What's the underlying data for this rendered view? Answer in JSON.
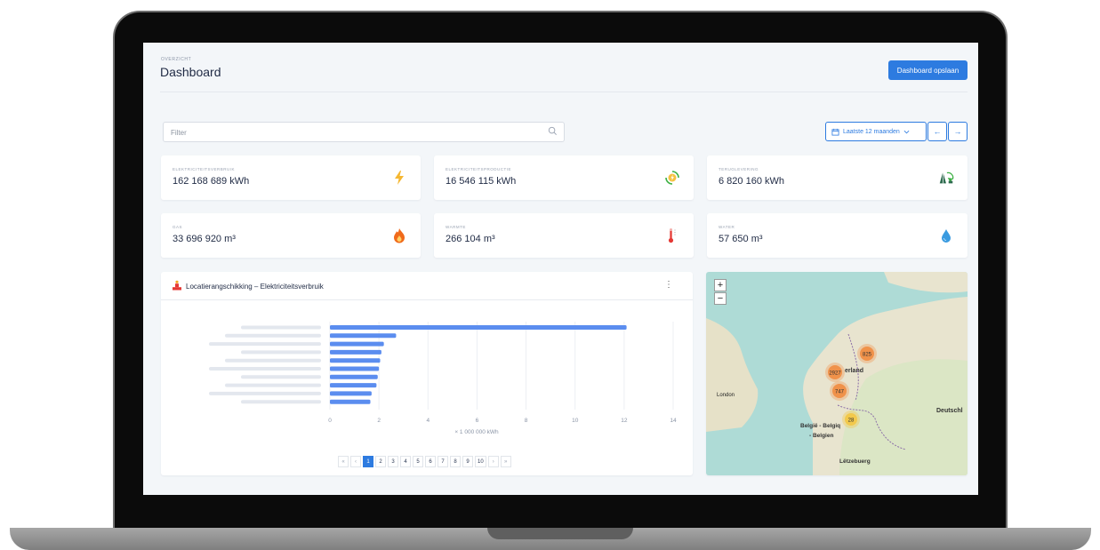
{
  "header": {
    "eyebrow": "OVERZICHT",
    "title": "Dashboard",
    "save_label": "Dashboard opslaan"
  },
  "filter": {
    "placeholder": "Filter"
  },
  "period": {
    "label": "Laatste 12 maanden",
    "prev": "←",
    "next": "→"
  },
  "kpis": [
    {
      "label": "ELEKTRICITEITSVERBRUIK",
      "value": "162 168 689 kWh",
      "icon": "lightning-icon",
      "color": "#f5b731"
    },
    {
      "label": "ELEKTRICITEITSPRODUCTIE",
      "value": "16 546 115 kWh",
      "icon": "solar-recycle-icon",
      "color": "#3cb043"
    },
    {
      "label": "TERUGLEVERING",
      "value": "6 820 160 kWh",
      "icon": "grid-return-icon",
      "color": "#2e7d5b"
    },
    {
      "label": "GAS",
      "value": "33 696 920 m³",
      "icon": "flame-icon",
      "color": "#f06a1a"
    },
    {
      "label": "WARMTE",
      "value": "266 104 m³",
      "icon": "thermometer-icon",
      "color": "#e53935"
    },
    {
      "label": "WATER",
      "value": "57 650 m³",
      "icon": "water-drop-icon",
      "color": "#3a9be0"
    }
  ],
  "chart": {
    "title": "Locatierangschikking – Elektriciteitsverbruik",
    "menu": "⋮"
  },
  "chart_data": {
    "type": "bar",
    "orientation": "horizontal",
    "categories": [
      "",
      "",
      "",
      "",
      "",
      "",
      "",
      "",
      "",
      ""
    ],
    "values": [
      12.1,
      2.7,
      2.2,
      2.1,
      2.05,
      2.0,
      1.95,
      1.9,
      1.7,
      1.65
    ],
    "xlim": [
      0,
      14
    ],
    "xticks": [
      "0",
      "2",
      "4",
      "6",
      "8",
      "10",
      "12",
      "14"
    ],
    "xlabel": "× 1 000 000 kWh",
    "bar_color": "#5b8def",
    "grid": true
  },
  "pagination": {
    "first": "«",
    "prev": "‹",
    "pages": [
      "1",
      "2",
      "3",
      "4",
      "5",
      "6",
      "7",
      "8",
      "9",
      "10"
    ],
    "next": "›",
    "last": "»",
    "active": "1"
  },
  "map": {
    "zoom_in": "+",
    "zoom_out": "−",
    "clusters": [
      {
        "label": "825",
        "color": "#f0924a"
      },
      {
        "label": "2927",
        "color": "#f0924a"
      },
      {
        "label": "747",
        "color": "#f0924a"
      },
      {
        "label": "28",
        "color": "#f2c94c"
      }
    ],
    "places": {
      "london": "London",
      "nederland": "erland",
      "belgie": "België - Belgiq",
      "belgien": "- Belgien",
      "deutschland": "Deutschl",
      "luxembourg": "Lëtzebuerg"
    }
  }
}
